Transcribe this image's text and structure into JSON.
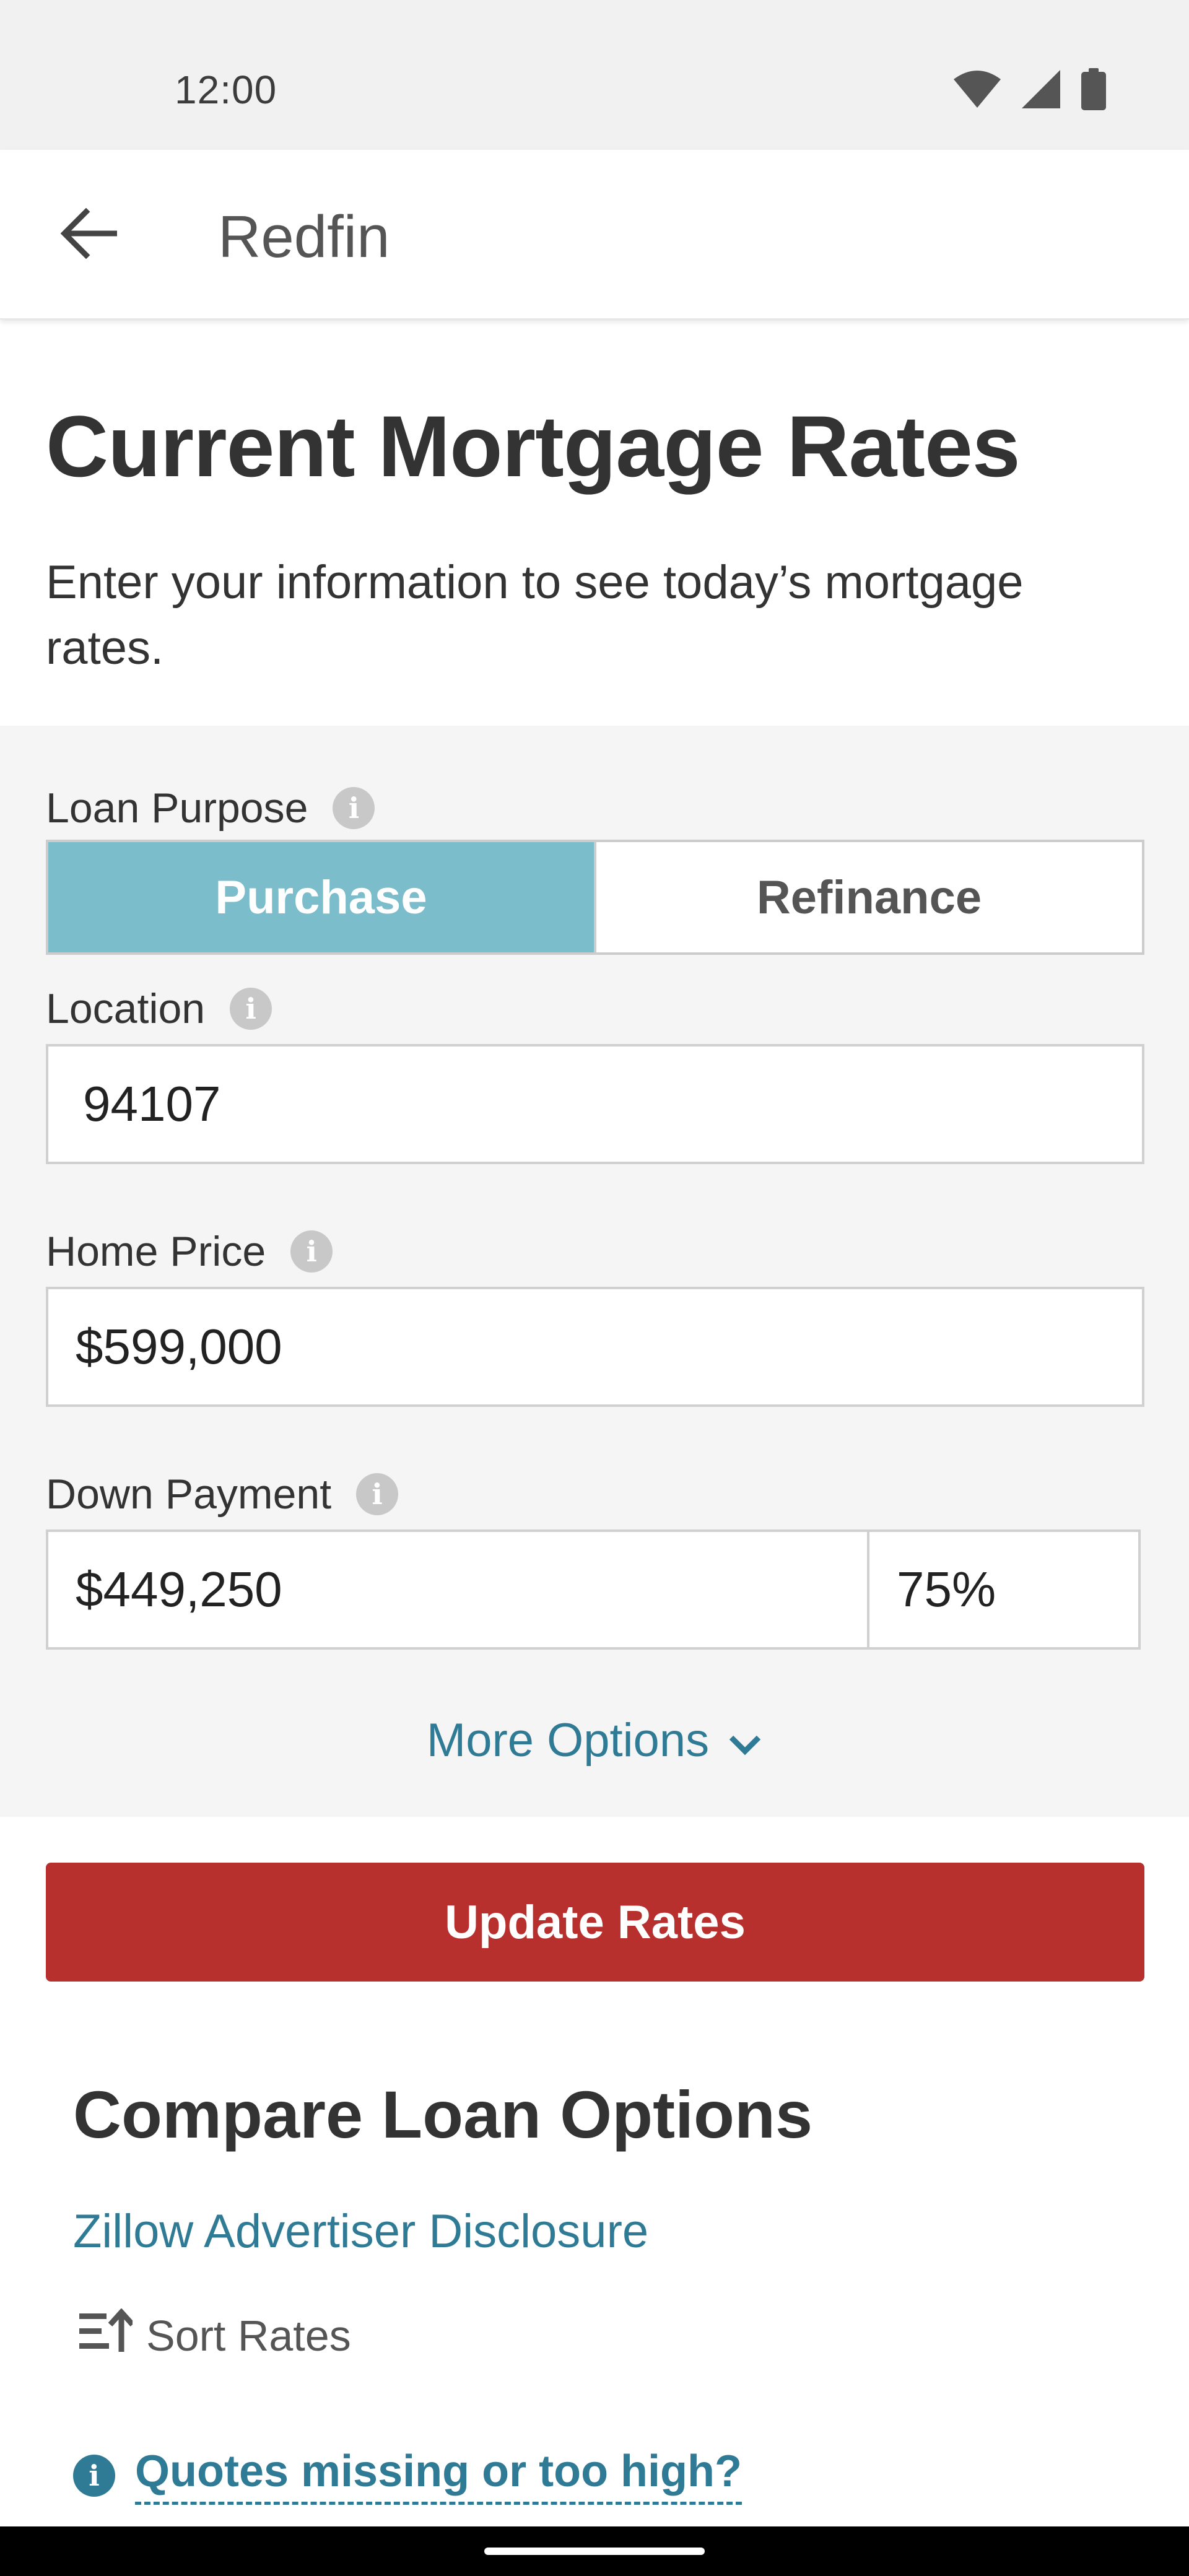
{
  "status_bar": {
    "time": "12:00",
    "icons": [
      "wifi-icon",
      "signal-icon",
      "battery-icon"
    ]
  },
  "app_bar": {
    "back_icon": "arrow-left-icon",
    "title": "Redfin"
  },
  "header": {
    "title": "Current Mortgage Rates",
    "subtitle": "Enter your information to see today’s mortgage rates."
  },
  "form": {
    "loan_purpose": {
      "label": "Loan Purpose",
      "options": [
        "Purchase",
        "Refinance"
      ],
      "selected": "Purchase"
    },
    "location": {
      "label": "Location",
      "value": "94107"
    },
    "home_price": {
      "label": "Home Price",
      "value": "$599,000"
    },
    "down_payment": {
      "label": "Down Payment",
      "amount": "$449,250",
      "percent": "75%"
    },
    "more_options_label": "More Options",
    "info_glyph": "i"
  },
  "update_button": "Update Rates",
  "compare": {
    "title": "Compare Loan Options",
    "disclosure_link": "Zillow Advertiser Disclosure",
    "sort_label": "Sort Rates",
    "quotes_link": "Quotes missing or too high?"
  },
  "colors": {
    "accent_teal": "#7cbdcc",
    "link_blue": "#2f7b96",
    "primary_red": "#b8302e",
    "form_bg": "#f5f5f5"
  }
}
